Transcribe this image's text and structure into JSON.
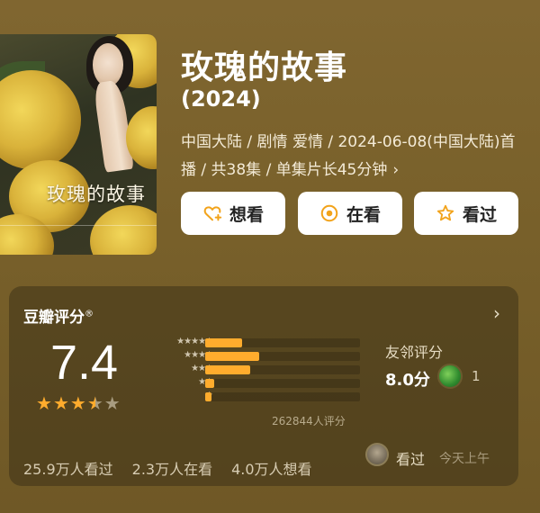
{
  "poster": {
    "title": "玫瑰的故事"
  },
  "movie": {
    "title": "玫瑰的故事",
    "year": "(2024)",
    "meta_line": "中国大陆 / 剧情 爱情 / 2024-06-08(中国大陆)首播 / 共38集 / 单集片长45分钟",
    "meta_chevron": "›"
  },
  "actions": {
    "want_label": "想看",
    "watching_label": "在看",
    "watched_label": "看过",
    "icon_color": "#f2a31b"
  },
  "rating": {
    "title": "豆瓣评分",
    "title_mark": "®",
    "chevron": "›",
    "score": "7.4",
    "stars": 3.5,
    "distribution": [
      {
        "stars": "★★★★★",
        "fraction": 0.24
      },
      {
        "stars": "★★★★",
        "fraction": 0.35
      },
      {
        "stars": "★★★",
        "fraction": 0.29
      },
      {
        "stars": "★★",
        "fraction": 0.06
      },
      {
        "stars": "★",
        "fraction": 0.04
      }
    ],
    "count_label": "262844人评分",
    "bar_color": "#ffac2d",
    "star_color": "#ffac2d"
  },
  "friends": {
    "label": "友邻评分",
    "score": "8.0分",
    "count": "1"
  },
  "stats": {
    "watched": "25.9万人看过",
    "watching": "2.3万人在看",
    "want": "4.0万人想看"
  },
  "latest_activity": {
    "action": "看过",
    "time": "今天上午"
  }
}
